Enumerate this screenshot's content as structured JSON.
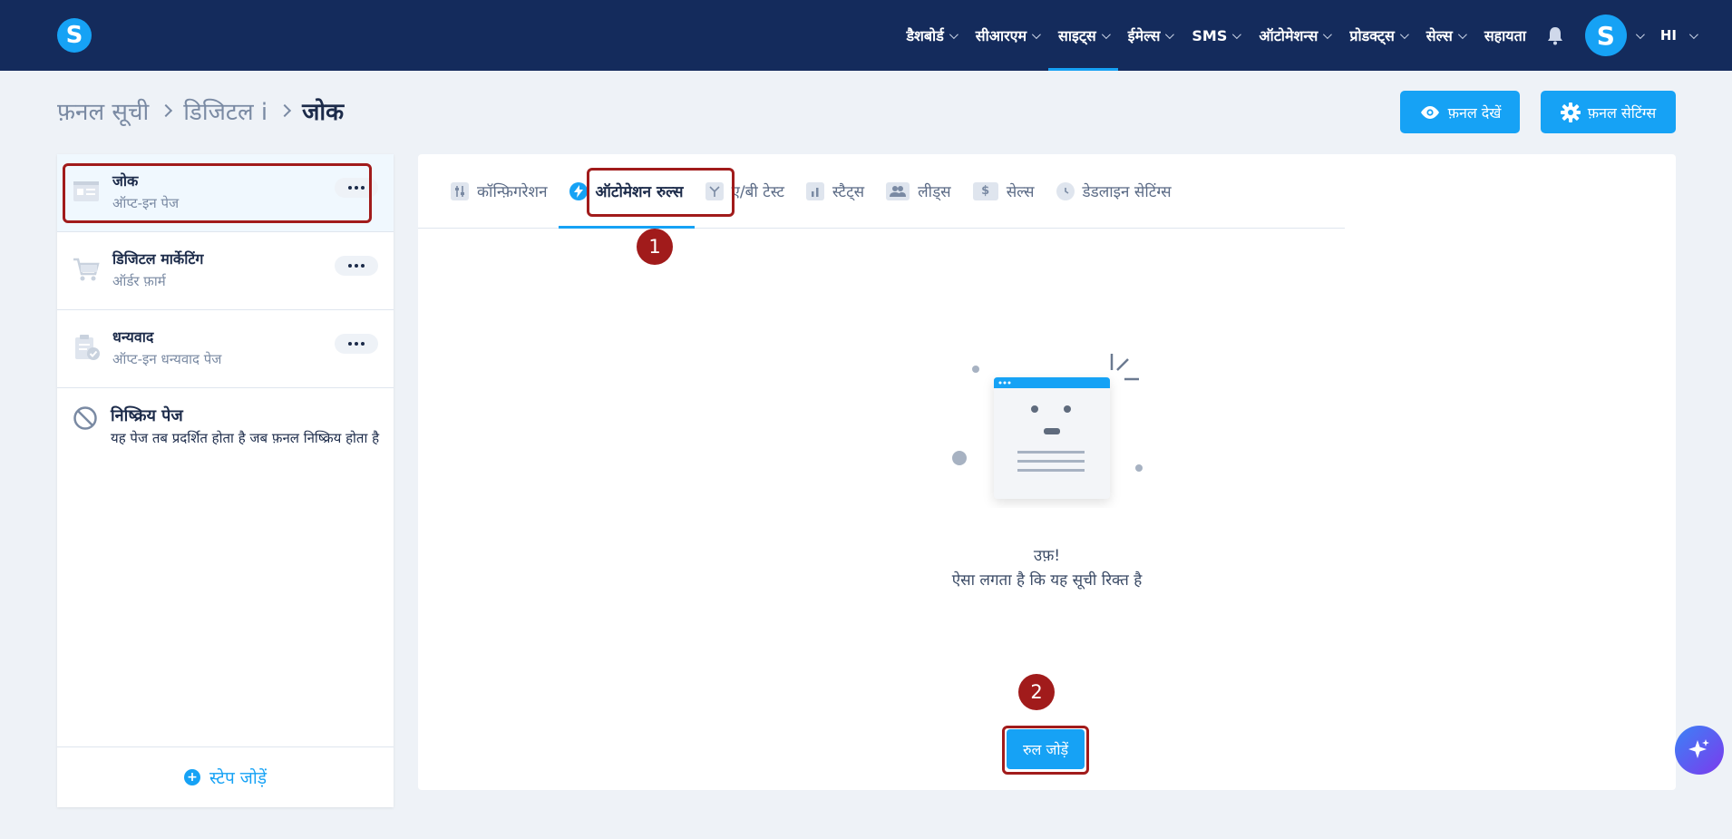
{
  "colors": {
    "nav_bg": "#142b5c",
    "accent": "#16a2f5",
    "highlight": "#a11b1b",
    "page_bg": "#eef2f7"
  },
  "app": {
    "logo_letter": "S",
    "avatar_letter": "S",
    "language": "HI"
  },
  "nav": {
    "items": [
      {
        "label": "डैशबोर्ड"
      },
      {
        "label": "सीआरएम"
      },
      {
        "label": "साइट्स"
      },
      {
        "label": "ईमेल्स"
      },
      {
        "label": "SMS"
      },
      {
        "label": "ऑटोमेशन्स"
      },
      {
        "label": "प्रोडक्ट्स"
      },
      {
        "label": "सेल्स"
      },
      {
        "label": "सहायता"
      }
    ]
  },
  "breadcrumb": {
    "items": [
      "फ़नल सूची",
      "डिजिटल i"
    ],
    "current": "जोक"
  },
  "header_buttons": {
    "view_funnel": "फ़नल देखें",
    "funnel_settings": "फ़नल सेटिंग्स"
  },
  "steps": [
    {
      "title": "जोक",
      "subtitle": "ऑप्ट-इन पेज"
    },
    {
      "title": "डिजिटल मार्केटिंग",
      "subtitle": "ऑर्डर फ़ार्म"
    },
    {
      "title": "धन्यवाद",
      "subtitle": "ऑप्ट-इन धन्यवाद पेज"
    }
  ],
  "inactive_page": {
    "title": "निष्क्रिय पेज",
    "description": "यह पेज तब प्रदर्शित होता है जब फ़नल निष्क्रिय होता है"
  },
  "add_step_label": "स्टेप जोड़ें",
  "tabs": [
    {
      "label": "कॉन्फ़िगरेशन"
    },
    {
      "label": "ऑटोमेशन रुल्स"
    },
    {
      "label": "ए/बी टेस्ट"
    },
    {
      "label": "स्टैट्स"
    },
    {
      "label": "लीड्स"
    },
    {
      "label": "सेल्स"
    },
    {
      "label": "डेडलाइन सेटिंग्स"
    }
  ],
  "markers": [
    "1",
    "2"
  ],
  "empty_state": {
    "title": "उफ़!",
    "description": "ऐसा लगता है कि यह सूची रिक्त है"
  },
  "add_rule_label": "रुल जोड़ें"
}
